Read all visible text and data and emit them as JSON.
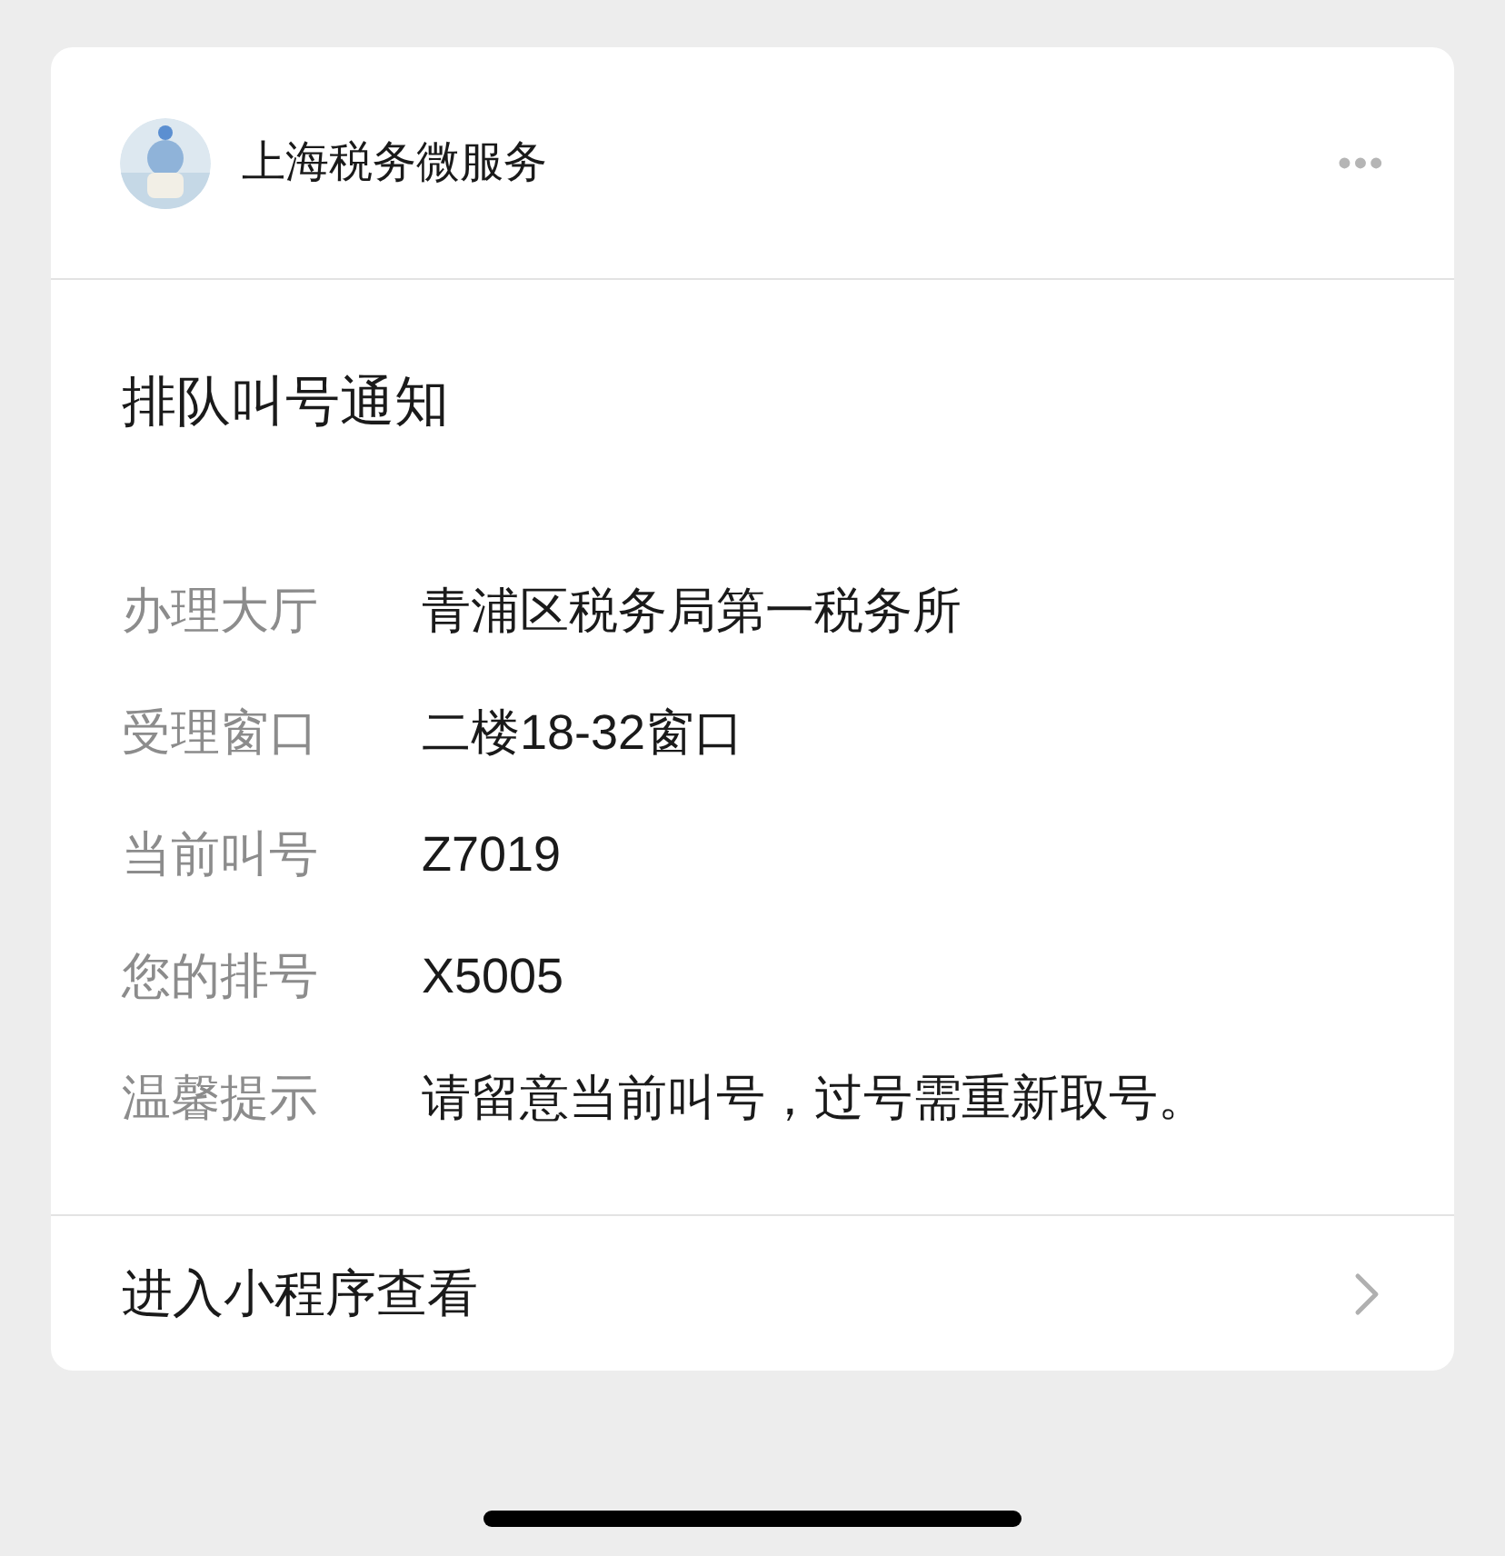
{
  "header": {
    "account": "上海税务微服务",
    "more": "•••"
  },
  "title": "排队叫号通知",
  "fields": [
    {
      "label": "办理大厅",
      "value": "青浦区税务局第一税务所"
    },
    {
      "label": "受理窗口",
      "value": "二楼18-32窗口"
    },
    {
      "label": "当前叫号",
      "value": "Z7019"
    },
    {
      "label": "您的排号",
      "value": "X5005"
    },
    {
      "label": "温馨提示",
      "value": "请留意当前叫号，过号需重新取号。"
    }
  ],
  "footer": {
    "link": "进入小程序查看"
  }
}
